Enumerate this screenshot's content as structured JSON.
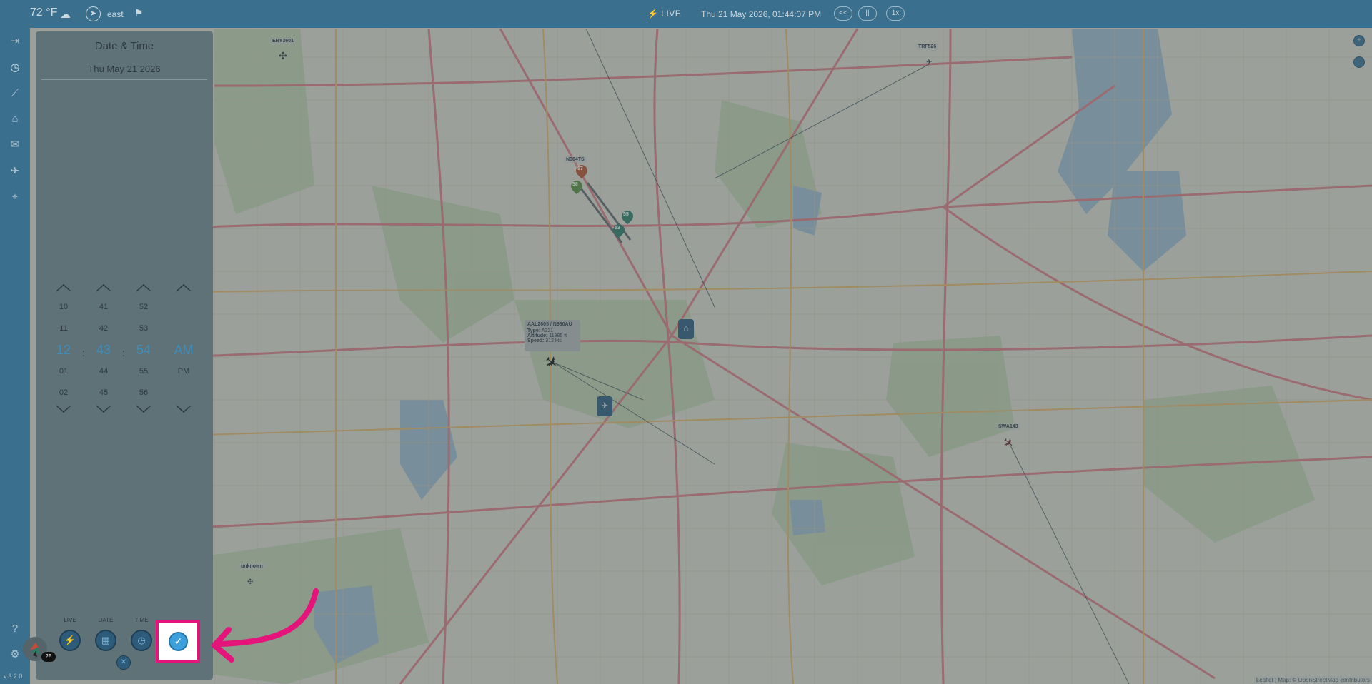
{
  "topbar": {
    "temperature": "72 °F",
    "wind_direction": "east",
    "live_label": "LIVE",
    "datetime": "Thu 21 May 2026, 01:44:07 PM",
    "rewind_label": "<<",
    "pause_label": "||",
    "speed_label": "1x"
  },
  "rail": {
    "icons": [
      "exit-icon",
      "clock-icon",
      "chart-icon",
      "home-icon",
      "inbox-icon",
      "airplane-icon",
      "location-pin-icon",
      "help-icon",
      "gear-icon"
    ],
    "version": "v.3.2.0"
  },
  "panel": {
    "title": "Date & Time",
    "date": "Thu May 21 2026",
    "time": {
      "hours": {
        "above": [
          "10",
          "11"
        ],
        "current": "12",
        "below": [
          "01",
          "02"
        ]
      },
      "minutes": {
        "above": [
          "41",
          "42"
        ],
        "current": "43",
        "below": [
          "44",
          "45"
        ]
      },
      "seconds": {
        "above": [
          "52",
          "53"
        ],
        "current": "54",
        "below": [
          "55",
          "56"
        ]
      },
      "period": {
        "current": "AM",
        "below": [
          "PM"
        ]
      }
    },
    "mode_buttons": {
      "live": "LIVE",
      "date": "DATE",
      "time": "TIME"
    },
    "notification_count": "25"
  },
  "map": {
    "aircraft_labels": {
      "eny": "ENY3601",
      "trf": "TRF526",
      "n964": "N964TS",
      "swa": "SWA143",
      "unknown": "unknown"
    },
    "tooltip": {
      "title": "AAL2605 / N930AU",
      "type_label": "Type:",
      "type_value": "A321",
      "altitude_label": "Altitude:",
      "altitude_value": "11985 ft",
      "speed_label": "Speed:",
      "speed_value": "312 kts"
    },
    "pins": {
      "p57": "57",
      "p58": "58",
      "p55": "55",
      "p53": "53"
    },
    "attribution": "Leaflet | Map: © OpenStreetMap contributors"
  },
  "colors": {
    "accent": "#3e8dbb",
    "highlight": "#e5147b",
    "topbar": "#3a6f8e"
  }
}
